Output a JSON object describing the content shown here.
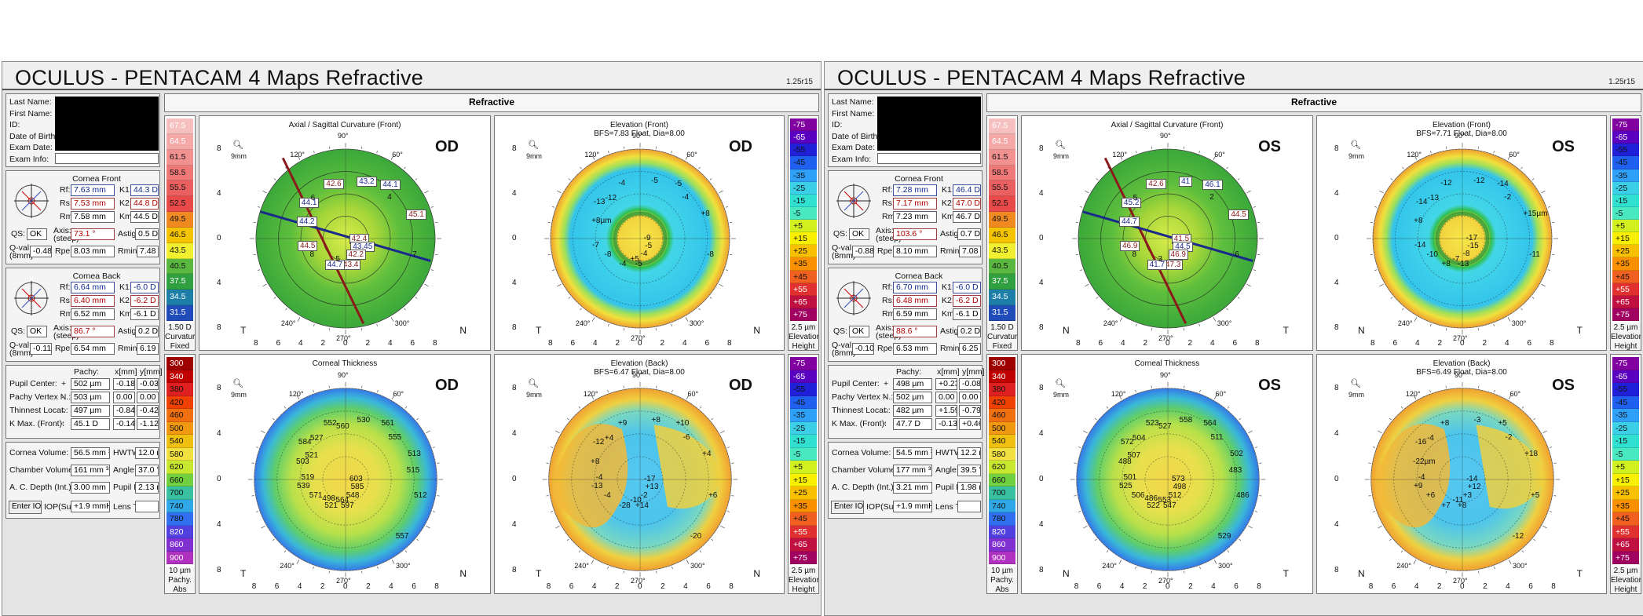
{
  "reports": [
    {
      "id": "od",
      "title": "OCULUS  -  PENTACAM   4 Maps Refractive",
      "version": "1.25r15",
      "patient_labels": [
        "Last Name:",
        "First Name:",
        "ID:",
        "Date of Birth:",
        "Exam Date:",
        "Exam Info:"
      ],
      "cornea_front": {
        "heading": "Cornea Front",
        "rf": "7.63 mm",
        "k1": "44.3 D",
        "rs": "7.53 mm",
        "k2": "44.8 D",
        "rm": "7.58 mm",
        "km": "44.5 D",
        "qs": "OK",
        "axis": "73.1 °",
        "astig": "0.5 D",
        "qval": "-0.48",
        "rper": "8.03 mm",
        "rmin": "7.48 mm"
      },
      "cornea_back": {
        "heading": "Cornea Back",
        "rf": "6.64 mm",
        "k1": "-6.0 D",
        "rs": "6.40 mm",
        "k2": "-6.2 D",
        "rm": "6.52 mm",
        "km": "-6.1 D",
        "qs": "OK",
        "axis": "86.7 °",
        "astig": "0.2 D",
        "qval": "-0.11",
        "rper": "6.54 mm",
        "rmin": "6.19 mm"
      },
      "pachy": {
        "col_pachy": "Pachy:",
        "col_x": "x[mm]",
        "col_y": "y[mm]",
        "rows": [
          {
            "label": "Pupil Center:",
            "sym": "+",
            "pachy": "502 µm",
            "x": "-0.18",
            "y": "-0.03"
          },
          {
            "label": "Pachy Vertex N.:",
            "sym": "·",
            "pachy": "503 µm",
            "x": "0.00",
            "y": "0.00"
          },
          {
            "label": "Thinnest Locat.:",
            "sym": "○",
            "pachy": "497 µm",
            "x": "-0.84",
            "y": "-0.42"
          },
          {
            "label": "K Max. (Front):",
            "sym": "◦",
            "pachy": "45.1 D",
            "x": "-0.14",
            "y": "-1.12"
          }
        ]
      },
      "volume": {
        "cornea_volume": "56.5 mm ³",
        "hwtw": "12.0 mm",
        "chamber_volume": "161 mm ³",
        "angle": "37.0 °",
        "ac_depth": "3.00 mm",
        "pupil_dia": "2.13 mm",
        "iop_sum": "+1.9 mmHg",
        "lens_th": ""
      },
      "maps_header": "Refractive",
      "eye": "OD",
      "corner_left": "T",
      "corner_right": "N",
      "curv_scale": [
        "67.5",
        "64.5",
        "61.5",
        "58.5",
        "55.5",
        "52.5",
        "49.5",
        "46.5",
        "43.5",
        "40.5",
        "37.5",
        "34.5",
        "31.5"
      ],
      "curv_foot": [
        "1.50 D",
        "Curvature",
        "Fixed"
      ],
      "elev_scale": [
        "-75",
        "-65",
        "-55",
        "-45",
        "-35",
        "-25",
        "-15",
        "-5",
        "+5",
        "+15",
        "+25",
        "+35",
        "+45",
        "+55",
        "+65",
        "+75"
      ],
      "elev_foot": [
        "2.5 µm",
        "Elevation",
        "Height"
      ],
      "thick_scale": [
        "300",
        "340",
        "380",
        "420",
        "460",
        "500",
        "540",
        "580",
        "620",
        "660",
        "700",
        "740",
        "780",
        "820",
        "860",
        "900"
      ],
      "thick_foot": [
        "10 µm",
        "Pachy.",
        "Abs"
      ],
      "maps": [
        {
          "title": "Axial / Sagittal Curvature (Front)",
          "subtitle": "",
          "values": [
            "42.4",
            "44.1",
            "43.4",
            "44.1",
            "44.5",
            "43.45",
            "42.6",
            "44.7",
            "45.1",
            "44.2",
            "42.2",
            "43.2",
            "8",
            "7",
            "6",
            "5",
            "4"
          ]
        },
        {
          "title": "Elevation (Front)",
          "subtitle": "BFS=7.83 Float, Dia=8.00",
          "values": [
            "-9",
            "-13",
            "-5",
            "-5",
            "-7",
            "-5",
            "-4",
            "-4",
            "+8",
            "+8µm",
            "-4",
            "-5",
            "-8",
            "-8",
            "-12",
            "+5",
            "-4"
          ]
        },
        {
          "title": "Corneal Thickness",
          "subtitle": "",
          "values": [
            "603",
            "584",
            "597",
            "561",
            "539",
            "585",
            "552",
            "521",
            "513",
            "503",
            "548",
            "530",
            "571",
            "512",
            "527",
            "564",
            "555",
            "519",
            "557",
            "560",
            "498",
            "515",
            "521"
          ]
        },
        {
          "title": "Elevation (Back)",
          "subtitle": "BFS=6.47 Float, Dia=8.00",
          "values": [
            "-17",
            "-12",
            "+14",
            "+10",
            "-13",
            "+13",
            "+9",
            "-28",
            "+4",
            "+8",
            "-2",
            "+8",
            "-4",
            "+6",
            "+4",
            "-10",
            "-6",
            "-4",
            "-20"
          ]
        }
      ],
      "axis_ticks": [
        "8",
        "6",
        "4",
        "2",
        "0",
        "2",
        "4",
        "6",
        "8"
      ],
      "deg": {
        "top": "90°",
        "bottom": "270°",
        "left": "180°",
        "tl": "120°",
        "tr": "60°",
        "bl": "240°",
        "br": "300°",
        "ltop": "150°",
        "rtop": "30°"
      },
      "mm_label": "9mm"
    },
    {
      "id": "os",
      "title": "OCULUS  -  PENTACAM   4 Maps Refractive",
      "version": "1.25r15",
      "patient_labels": [
        "Last Name:",
        "First Name:",
        "ID:",
        "Date of Birth:",
        "Exam Date:",
        "Exam Info:"
      ],
      "cornea_front": {
        "heading": "Cornea Front",
        "rf": "7.28 mm",
        "k1": "46.4 D",
        "rs": "7.17 mm",
        "k2": "47.0 D",
        "rm": "7.23 mm",
        "km": "46.7 D",
        "qs": "OK",
        "axis": "103.6 °",
        "astig": "0.7 D",
        "qval": "-0.88",
        "rper": "8.10 mm",
        "rmin": "7.08 mm"
      },
      "cornea_back": {
        "heading": "Cornea Back",
        "rf": "6.70 mm",
        "k1": "-6.0 D",
        "rs": "6.48 mm",
        "k2": "-6.2 D",
        "rm": "6.59 mm",
        "km": "-6.1 D",
        "qs": "OK",
        "axis": "88.6 °",
        "astig": "0.2 D",
        "qval": "-0.10",
        "rper": "6.53 mm",
        "rmin": "6.25 mm"
      },
      "pachy": {
        "col_pachy": "Pachy:",
        "col_x": "x[mm]",
        "col_y": "y[mm]",
        "rows": [
          {
            "label": "Pupil Center:",
            "sym": "+",
            "pachy": "498 µm",
            "x": "+0.23",
            "y": "-0.08"
          },
          {
            "label": "Pachy Vertex N.:",
            "sym": "·",
            "pachy": "502 µm",
            "x": "0.00",
            "y": "0.00"
          },
          {
            "label": "Thinnest Locat.:",
            "sym": "○",
            "pachy": "482 µm",
            "x": "+1.59",
            "y": "-0.79"
          },
          {
            "label": "K Max. (Front):",
            "sym": "◦",
            "pachy": "47.7 D",
            "x": "-0.13",
            "y": "+0.46"
          }
        ]
      },
      "volume": {
        "cornea_volume": "54.5 mm ³",
        "hwtw": "12.2 mm",
        "chamber_volume": "177 mm ³",
        "angle": "39.5 °",
        "ac_depth": "3.21 mm",
        "pupil_dia": "1.98 mm",
        "iop_sum": "+1.9 mmHg",
        "lens_th": ""
      },
      "maps_header": "Refractive",
      "eye": "OS",
      "corner_left": "N",
      "corner_right": "T",
      "curv_scale": [
        "67.5",
        "64.5",
        "61.5",
        "58.5",
        "55.5",
        "52.5",
        "49.5",
        "46.5",
        "43.5",
        "40.5",
        "37.5",
        "34.5",
        "31.5"
      ],
      "curv_foot": [
        "1.50 D",
        "Curvature",
        "Fixed"
      ],
      "elev_scale": [
        "-75",
        "-65",
        "-55",
        "-45",
        "-35",
        "-25",
        "-15",
        "-5",
        "+5",
        "+15",
        "+25",
        "+35",
        "+45",
        "+55",
        "+65",
        "+75"
      ],
      "elev_foot": [
        "2.5 µm",
        "Elevation",
        "Height"
      ],
      "thick_scale": [
        "300",
        "340",
        "380",
        "420",
        "460",
        "500",
        "540",
        "580",
        "620",
        "660",
        "700",
        "740",
        "780",
        "820",
        "860",
        "900"
      ],
      "thick_foot": [
        "10 µm",
        "Pachy.",
        "Abs"
      ],
      "maps": [
        {
          "title": "Axial / Sagittal Curvature (Front)",
          "subtitle": "",
          "values": [
            "41.5",
            "45.2",
            "47.3",
            "46.1",
            "46.9",
            "44.5",
            "42.6",
            "41.7",
            "44.5",
            "44.7",
            "46.9",
            "41",
            "8",
            "6",
            "5",
            "3",
            "2"
          ]
        },
        {
          "title": "Elevation (Front)",
          "subtitle": "BFS=7.71 Float, Dia=8.00",
          "values": [
            "-17",
            "-14",
            "-13",
            "-14",
            "-14",
            "-15",
            "-12",
            "+8",
            "+15µm",
            "+8",
            "-8",
            "-12",
            "-10",
            "-11",
            "-13",
            "-7",
            "-2"
          ]
        },
        {
          "title": "Corneal Thickness",
          "subtitle": "",
          "values": [
            "573",
            "572",
            "547",
            "564",
            "525",
            "498",
            "523",
            "522",
            "502",
            "488",
            "512",
            "558",
            "506",
            "486",
            "504",
            "553",
            "511",
            "501",
            "529",
            "527",
            "486",
            "483",
            "507"
          ]
        },
        {
          "title": "Elevation (Back)",
          "subtitle": "BFS=6.49 Float, Dia=8.00",
          "values": [
            "-14",
            "-16",
            "+8",
            "+5",
            "+9",
            "+12",
            "+8",
            "+7",
            "+18",
            "-22µm",
            "+3",
            "-3",
            "+6",
            "+5",
            "-4",
            "-11",
            "-2",
            "-4",
            "-12"
          ]
        }
      ],
      "axis_ticks": [
        "8",
        "6",
        "4",
        "2",
        "0",
        "2",
        "4",
        "6",
        "8"
      ],
      "deg": {
        "top": "90°",
        "bottom": "270°",
        "left": "180°",
        "tl": "120°",
        "tr": "60°",
        "bl": "240°",
        "br": "300°",
        "ltop": "150°",
        "rtop": "30°"
      },
      "mm_label": "9mm"
    }
  ],
  "labels": {
    "rf": "Rf:",
    "rs": "Rs:",
    "rm": "Rm:",
    "k1": "K1:",
    "k2": "K2:",
    "km": "Km:",
    "qs": "QS:",
    "axis": "Axis:",
    "steep": "(steep)",
    "astig": "Astig:",
    "qval": "Q-val.:",
    "qval2": "(8mm)",
    "rper": "Rper:",
    "rmin": "Rmin:",
    "cornea_volume": "Cornea Volume:",
    "hwtw": "HWTW:",
    "chamber_volume": "Chamber Volume:",
    "angle": "Angle:",
    "ac_depth": "A. C. Depth (Int.):",
    "pupil_dia": "Pupil Dia:",
    "enter_iop": "Enter IOP",
    "iop_sum": "IOP(Sum):",
    "lens_th": "Lens Th.:"
  },
  "colors": {
    "panel_bg": "#e4e4e4",
    "blue_text": "#102a8c",
    "red_text": "#b00000",
    "scale_curv": [
      "#f7c0c0",
      "#f5a8a8",
      "#f39090",
      "#ef7878",
      "#ea6060",
      "#e84a4a",
      "#f08a20",
      "#f4c400",
      "#f0f030",
      "#5ab840",
      "#2f9f3f",
      "#1d7fa8",
      "#1f4cb8"
    ],
    "scale_elev": [
      "#8000a0",
      "#5a00c0",
      "#2020d8",
      "#2060f0",
      "#2ea0f8",
      "#3ccfe8",
      "#30e0d0",
      "#48e8c0",
      "#d0f020",
      "#f8f000",
      "#f8c000",
      "#f89000",
      "#f06020",
      "#e03030",
      "#c01040",
      "#a00060"
    ],
    "scale_thick": [
      "#9e0000",
      "#c00000",
      "#e02020",
      "#f04000",
      "#f07010",
      "#f09810",
      "#f0c010",
      "#f0e040",
      "#c8e830",
      "#70d040",
      "#38c0a0",
      "#30a8e8",
      "#3070f0",
      "#5040e0",
      "#8030d0",
      "#b030c0"
    ]
  }
}
